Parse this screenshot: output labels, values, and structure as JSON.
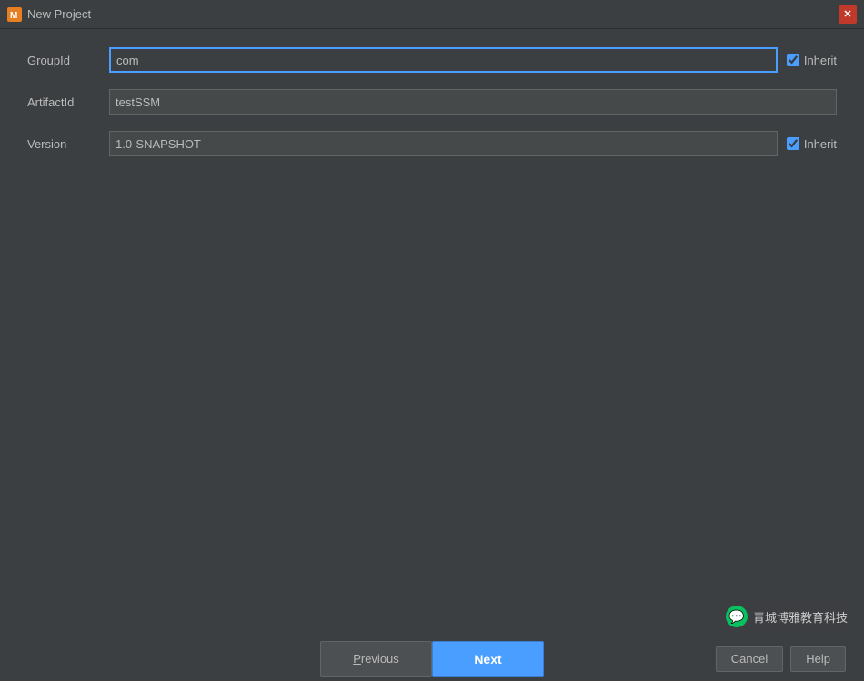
{
  "titleBar": {
    "title": "New Project",
    "icon": "🔧",
    "closeLabel": "✕"
  },
  "form": {
    "groupId": {
      "label": "GroupId",
      "value": "com",
      "inheritLabel": "Inherit",
      "inheritChecked": true,
      "focused": true
    },
    "artifactId": {
      "label": "ArtifactId",
      "value": "testSSM"
    },
    "version": {
      "label": "Version",
      "value": "1.0-SNAPSHOT",
      "inheritLabel": "Inherit",
      "inheritChecked": true
    }
  },
  "buttons": {
    "previous": "Previous",
    "next": "Next",
    "cancel": "Cancel",
    "help": "Help"
  },
  "watermark": {
    "text": "青城博雅教育科技"
  }
}
